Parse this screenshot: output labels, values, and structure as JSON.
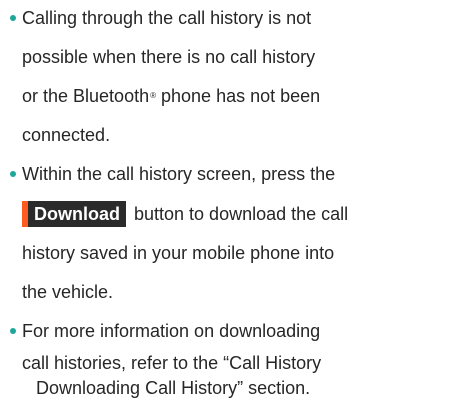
{
  "notes": [
    {
      "lines": [
        "Calling through the call history is not",
        "possible when there is no call history",
        "or the Bluetooth",
        "phone has not been",
        "connected."
      ],
      "reg_mark": "®"
    },
    {
      "lines": [
        "Within the call history screen, press the",
        "button to download the call",
        "history saved in your mobile phone into",
        "the vehicle."
      ],
      "button_label": "Download"
    },
    {
      "lines": [
        "For more information on downloading",
        "call histories, refer to the “Call History",
        "Downloading Call History” section."
      ]
    }
  ],
  "colors": {
    "bullet": "#1fa69a",
    "button_bg": "#2b2b2b",
    "button_accent": "#ff5a1f",
    "text": "#262626"
  }
}
